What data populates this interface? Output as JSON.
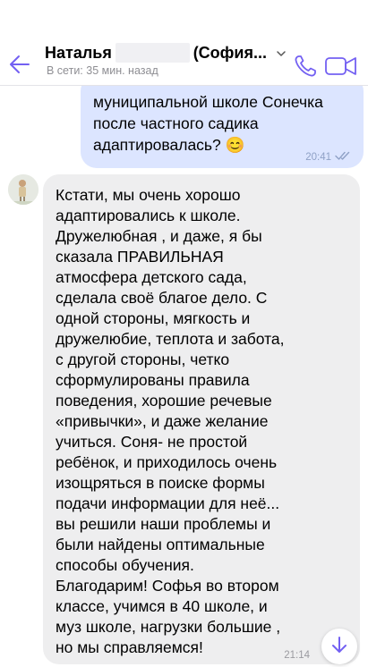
{
  "header": {
    "contact_name_first": "Наталья",
    "contact_name_second": "(София...",
    "status": "В сети: 35 мин. назад"
  },
  "colors": {
    "accent": "#7360f2",
    "outgoing_bubble": "#dce5ff",
    "incoming_bubble": "#eeeeef"
  },
  "icons": {
    "back": "back-arrow-icon",
    "chevron": "chevron-down-icon",
    "call": "phone-icon",
    "video": "video-camera-icon",
    "read": "double-check-icon",
    "scroll": "arrow-down-icon"
  },
  "messages": {
    "outgoing": {
      "lines": [
        "муниципальной школе Сонечка",
        "после частного садика",
        "адаптировалась? 😊"
      ],
      "time": "20:41"
    },
    "incoming": {
      "lines": [
        "Кстати, мы очень хорошо",
        "адаптировались к школе.",
        "Дружелюбная , и даже, я бы",
        "сказала ПРАВИЛЬНАЯ",
        "атмосфера детского сада,",
        "сделала своё благое дело. С",
        "одной стороны, мягкость и",
        "дружелюбие, теплота и забота,",
        "с другой стороны, четко",
        "сформулированы правила",
        "поведения, хорошие речевые",
        "«привычки», и даже желание",
        "учиться. Соня- не простой",
        "ребёнок, и приходилось очень",
        "изощряться в поиске формы",
        "подачи информации для неё...",
        "вы решили наши проблемы и",
        "были найдены оптимальные",
        "способы обучения.",
        "Благодарим! Софья во втором",
        "классе, учимся в 40 школе, и",
        "муз школе, нагрузки большие ,",
        "но мы справляемся!"
      ],
      "time": "21:14"
    }
  }
}
